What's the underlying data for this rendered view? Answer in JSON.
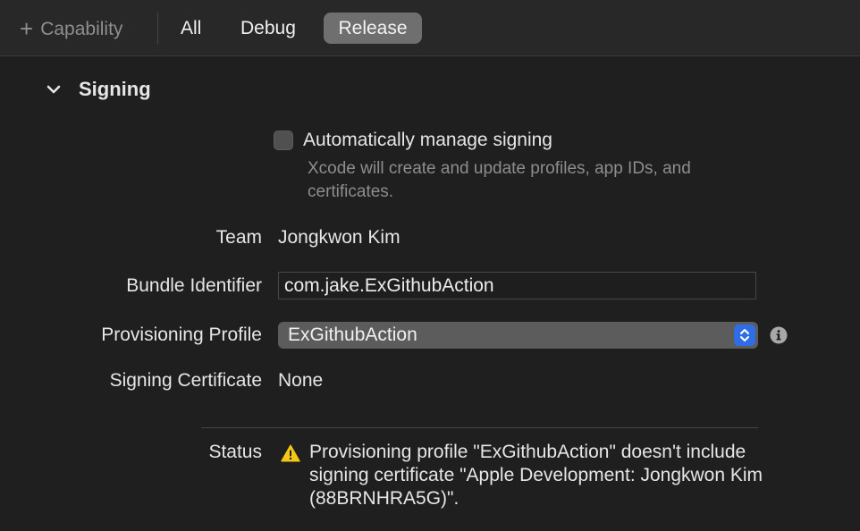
{
  "toolbar": {
    "add_capability_label": "Capability",
    "configs": [
      {
        "label": "All"
      },
      {
        "label": "Debug"
      },
      {
        "label": "Release",
        "selected": true
      }
    ]
  },
  "signing": {
    "section_title": "Signing",
    "auto_manage": {
      "label": "Automatically manage signing",
      "description": "Xcode will create and update profiles, app IDs, and certificates.",
      "checked": false
    },
    "team": {
      "label": "Team",
      "value": "Jongkwon Kim"
    },
    "bundle_id": {
      "label": "Bundle Identifier",
      "value": "com.jake.ExGithubAction"
    },
    "provisioning_profile": {
      "label": "Provisioning Profile",
      "value": "ExGithubAction"
    },
    "signing_certificate": {
      "label": "Signing Certificate",
      "value": "None"
    },
    "status": {
      "label": "Status",
      "message": "Provisioning profile \"ExGithubAction\" doesn't include signing certificate \"Apple Development: Jongkwon Kim (88BRNHRA5G)\"."
    }
  },
  "colors": {
    "background": "#1f1f1f",
    "selected_segment": "#6f6f6f",
    "accent": "#2e6de5",
    "warning": "#f5c518"
  },
  "icons": [
    "plus-icon",
    "chevron-down-icon",
    "checkbox-icon",
    "up-down-stepper-icon",
    "info-icon",
    "warning-icon"
  ]
}
